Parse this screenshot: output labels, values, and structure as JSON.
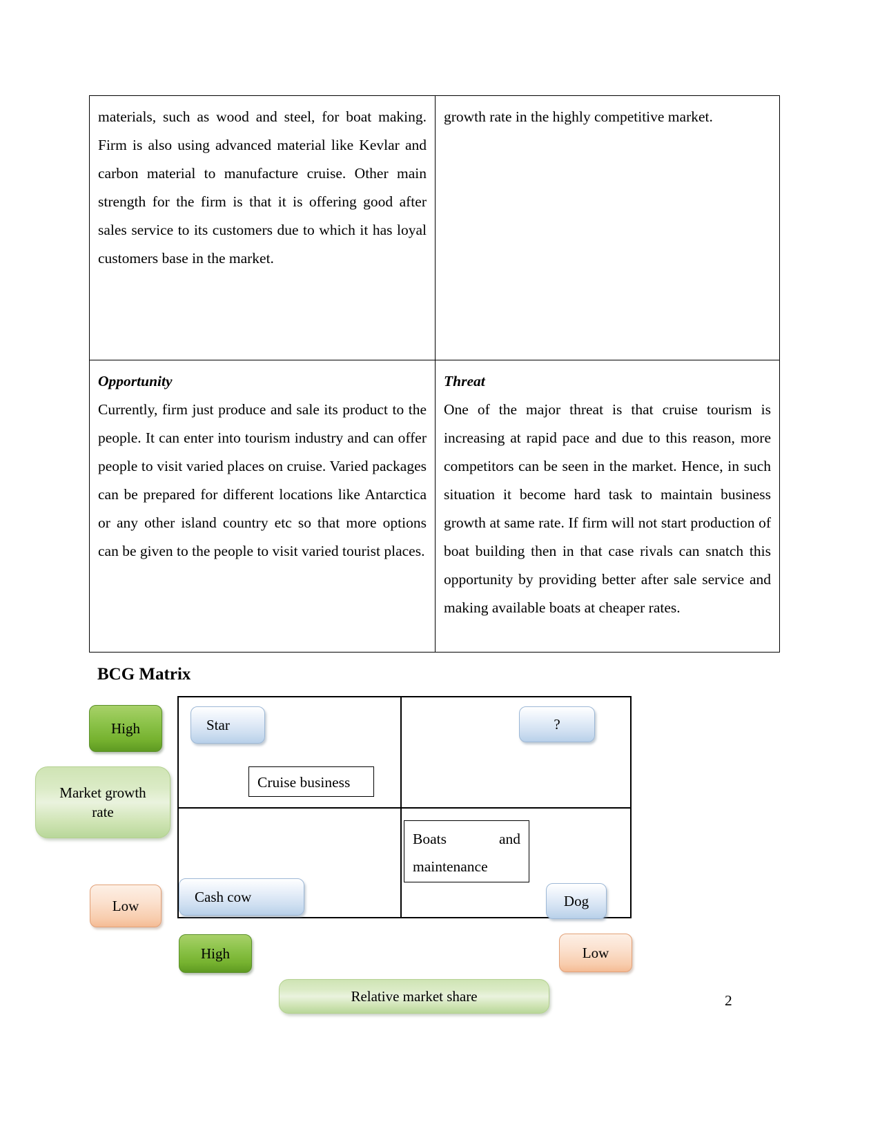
{
  "document": {
    "page_number": "2"
  },
  "swot": {
    "rows": [
      {
        "left": {
          "title": "",
          "body": "materials, such as wood and steel, for boat making. Firm is also using advanced material like Kevlar and carbon material to manufacture cruise.\nOther main strength for the firm is that it is offering good after sales service to its customers due to which it has loyal customers base in the market."
        },
        "right": {
          "title": "",
          "body": "growth rate in the highly competitive market."
        }
      },
      {
        "left": {
          "title": "Opportunity",
          "body": "Currently, firm just produce and sale its product to the people. It can enter into tourism industry and can offer people to visit varied places on cruise. Varied packages can be prepared for different locations like Antarctica or any other island country etc so that more options can be given to the people to visit varied tourist places."
        },
        "right": {
          "title": "Threat",
          "body": "One of the major threat is that cruise tourism is increasing at rapid pace and due to this reason, more competitors can be seen in the market. Hence, in such situation it become hard task to maintain business growth at same rate. If firm will not start production of boat building then in that case rivals can snatch this opportunity by providing better after sale service and making available boats at cheaper rates."
        }
      }
    ]
  },
  "bcg": {
    "heading": "BCG Matrix",
    "y_axis": {
      "high_label": "High",
      "low_label": "Low",
      "axis_title": "Market growth\nrate"
    },
    "x_axis": {
      "high_label": "High",
      "low_label": "Low",
      "axis_title": "Relative market share"
    },
    "quadrants": {
      "star": "Star",
      "question_mark": "?",
      "cash_cow": "Cash cow",
      "dog": "Dog"
    },
    "items": {
      "cruise_business": "Cruise business",
      "boats_and_maintenance": "Boats and maintenance"
    },
    "colors": {
      "quadrant_label_fill": "#cfdff1",
      "quadrant_label_border": "#9db8d6",
      "green_dark": "#76b22f",
      "green_light": "#cfe4b4",
      "peach": "#f8cdae",
      "grid_line": "#000000"
    }
  }
}
